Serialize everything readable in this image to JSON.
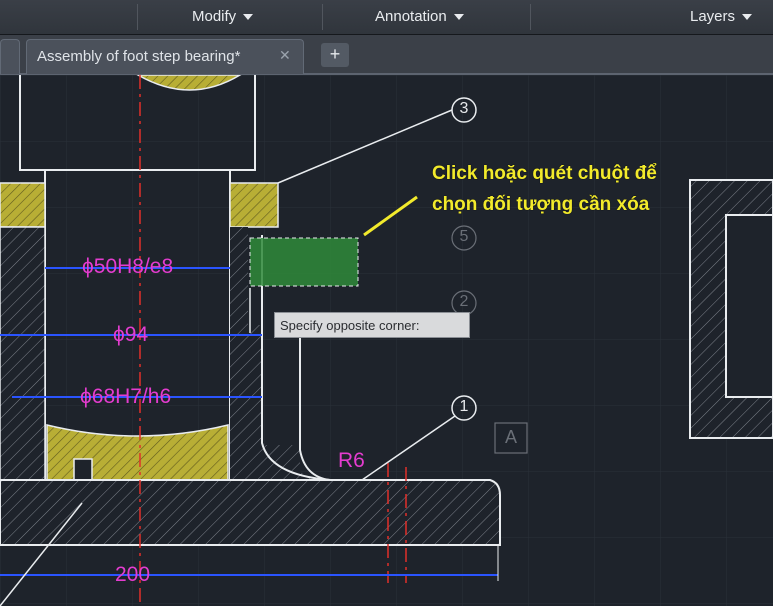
{
  "ribbon": {
    "panels": [
      {
        "label": "Modify"
      },
      {
        "label": "Annotation"
      },
      {
        "label": "Layers"
      }
    ]
  },
  "tabs": {
    "active_label": "Assembly of foot step bearing*",
    "close_symbol": "✕",
    "new_symbol": "+"
  },
  "drawing": {
    "dimensions": {
      "d1": "ϕ50H8/e8",
      "d2": "ϕ94",
      "d3": "ϕ68H7/h6",
      "radius": "R6",
      "length": "200"
    },
    "balloons": {
      "b3": "3",
      "b5": "5",
      "b2": "2",
      "b1": "1",
      "section": "A"
    },
    "tooltip": "Specify opposite corner:",
    "annotation_line1": "Click hoặc quét chuột để",
    "annotation_line2": "chọn đối tượng cần xóa"
  },
  "colors": {
    "background": "#1e232b",
    "dimension": "#e43ccf",
    "hatch": "#c9bf3a",
    "selection": "#2f8a3a",
    "centerline": "#e0302a",
    "annotation": "#f2ea2c"
  }
}
